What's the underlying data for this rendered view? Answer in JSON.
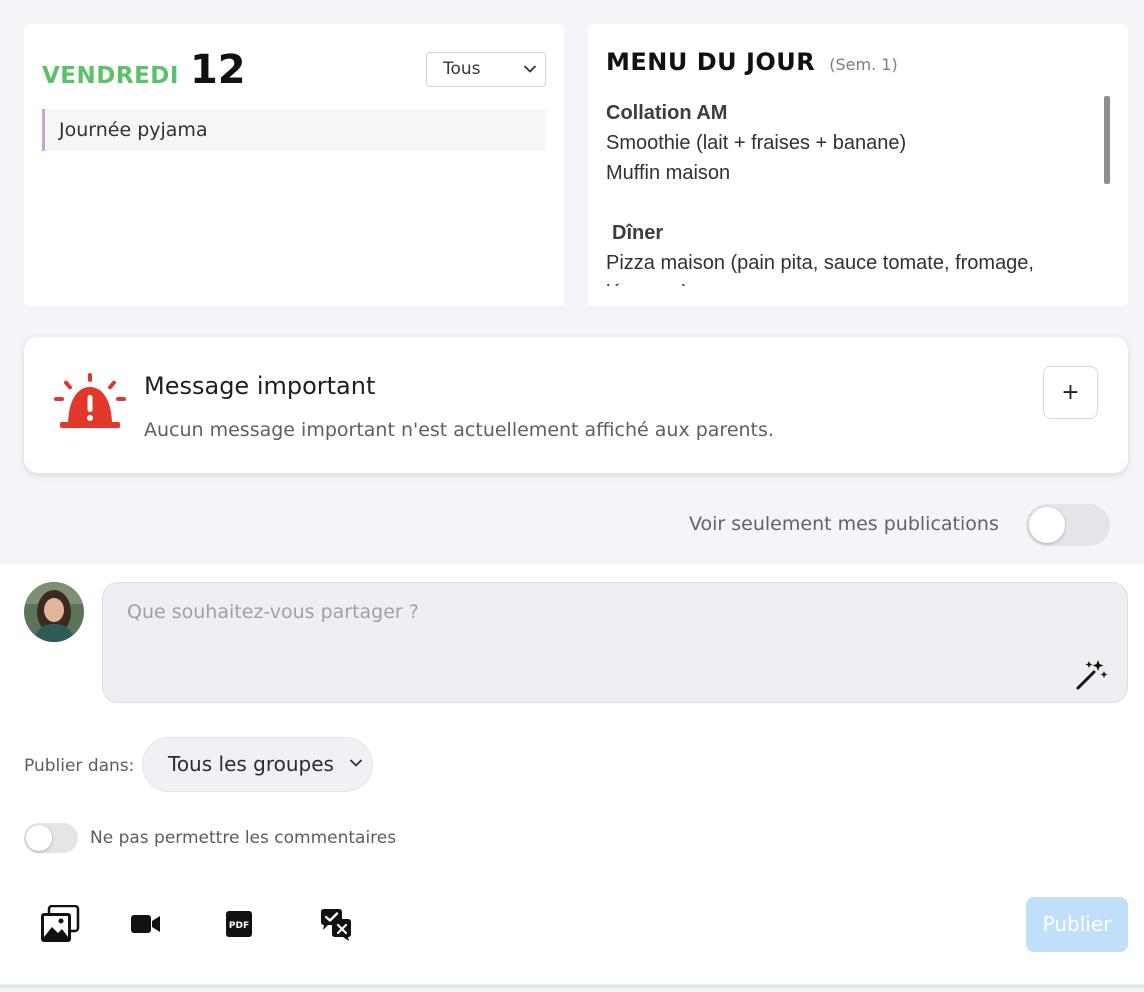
{
  "day": {
    "weekday": "VENDREDI",
    "date_number": "12",
    "group_filter": "Tous",
    "events": [
      "Journée pyjama"
    ]
  },
  "menu": {
    "title": "MENU DU JOUR",
    "week": "(Sem. 1)",
    "sections": [
      {
        "title": "Collation AM",
        "lines": [
          "Smoothie (lait + fraises + banane)",
          "Muffin maison"
        ]
      },
      {
        "title": "Dîner",
        "lines": [
          "Pizza maison (pain pita, sauce tomate, fromage,",
          "légumes)"
        ]
      }
    ]
  },
  "important_message": {
    "title": "Message important",
    "description": "Aucun message important n'est actuellement affiché aux parents.",
    "add_label": "+",
    "icon": "alarm-light-icon",
    "icon_color": "#e2382b"
  },
  "filter": {
    "my_posts_label": "Voir seulement mes publications",
    "my_posts_enabled": false
  },
  "composer": {
    "placeholder": "Que souhaitez-vous partager ?",
    "publish_in_label": "Publier dans:",
    "groups_value": "Tous les groupes",
    "no_comments_label": "Ne pas permettre les commentaires",
    "no_comments_enabled": false,
    "publish_label": "Publier",
    "tools": [
      "photo-gallery-icon",
      "video-camera-icon",
      "pdf-file-icon",
      "translate-chat-icon"
    ]
  },
  "colors": {
    "accent_green": "#5cc26a",
    "alert_red": "#e2382b",
    "publish_disabled": "#bfe0f8"
  }
}
